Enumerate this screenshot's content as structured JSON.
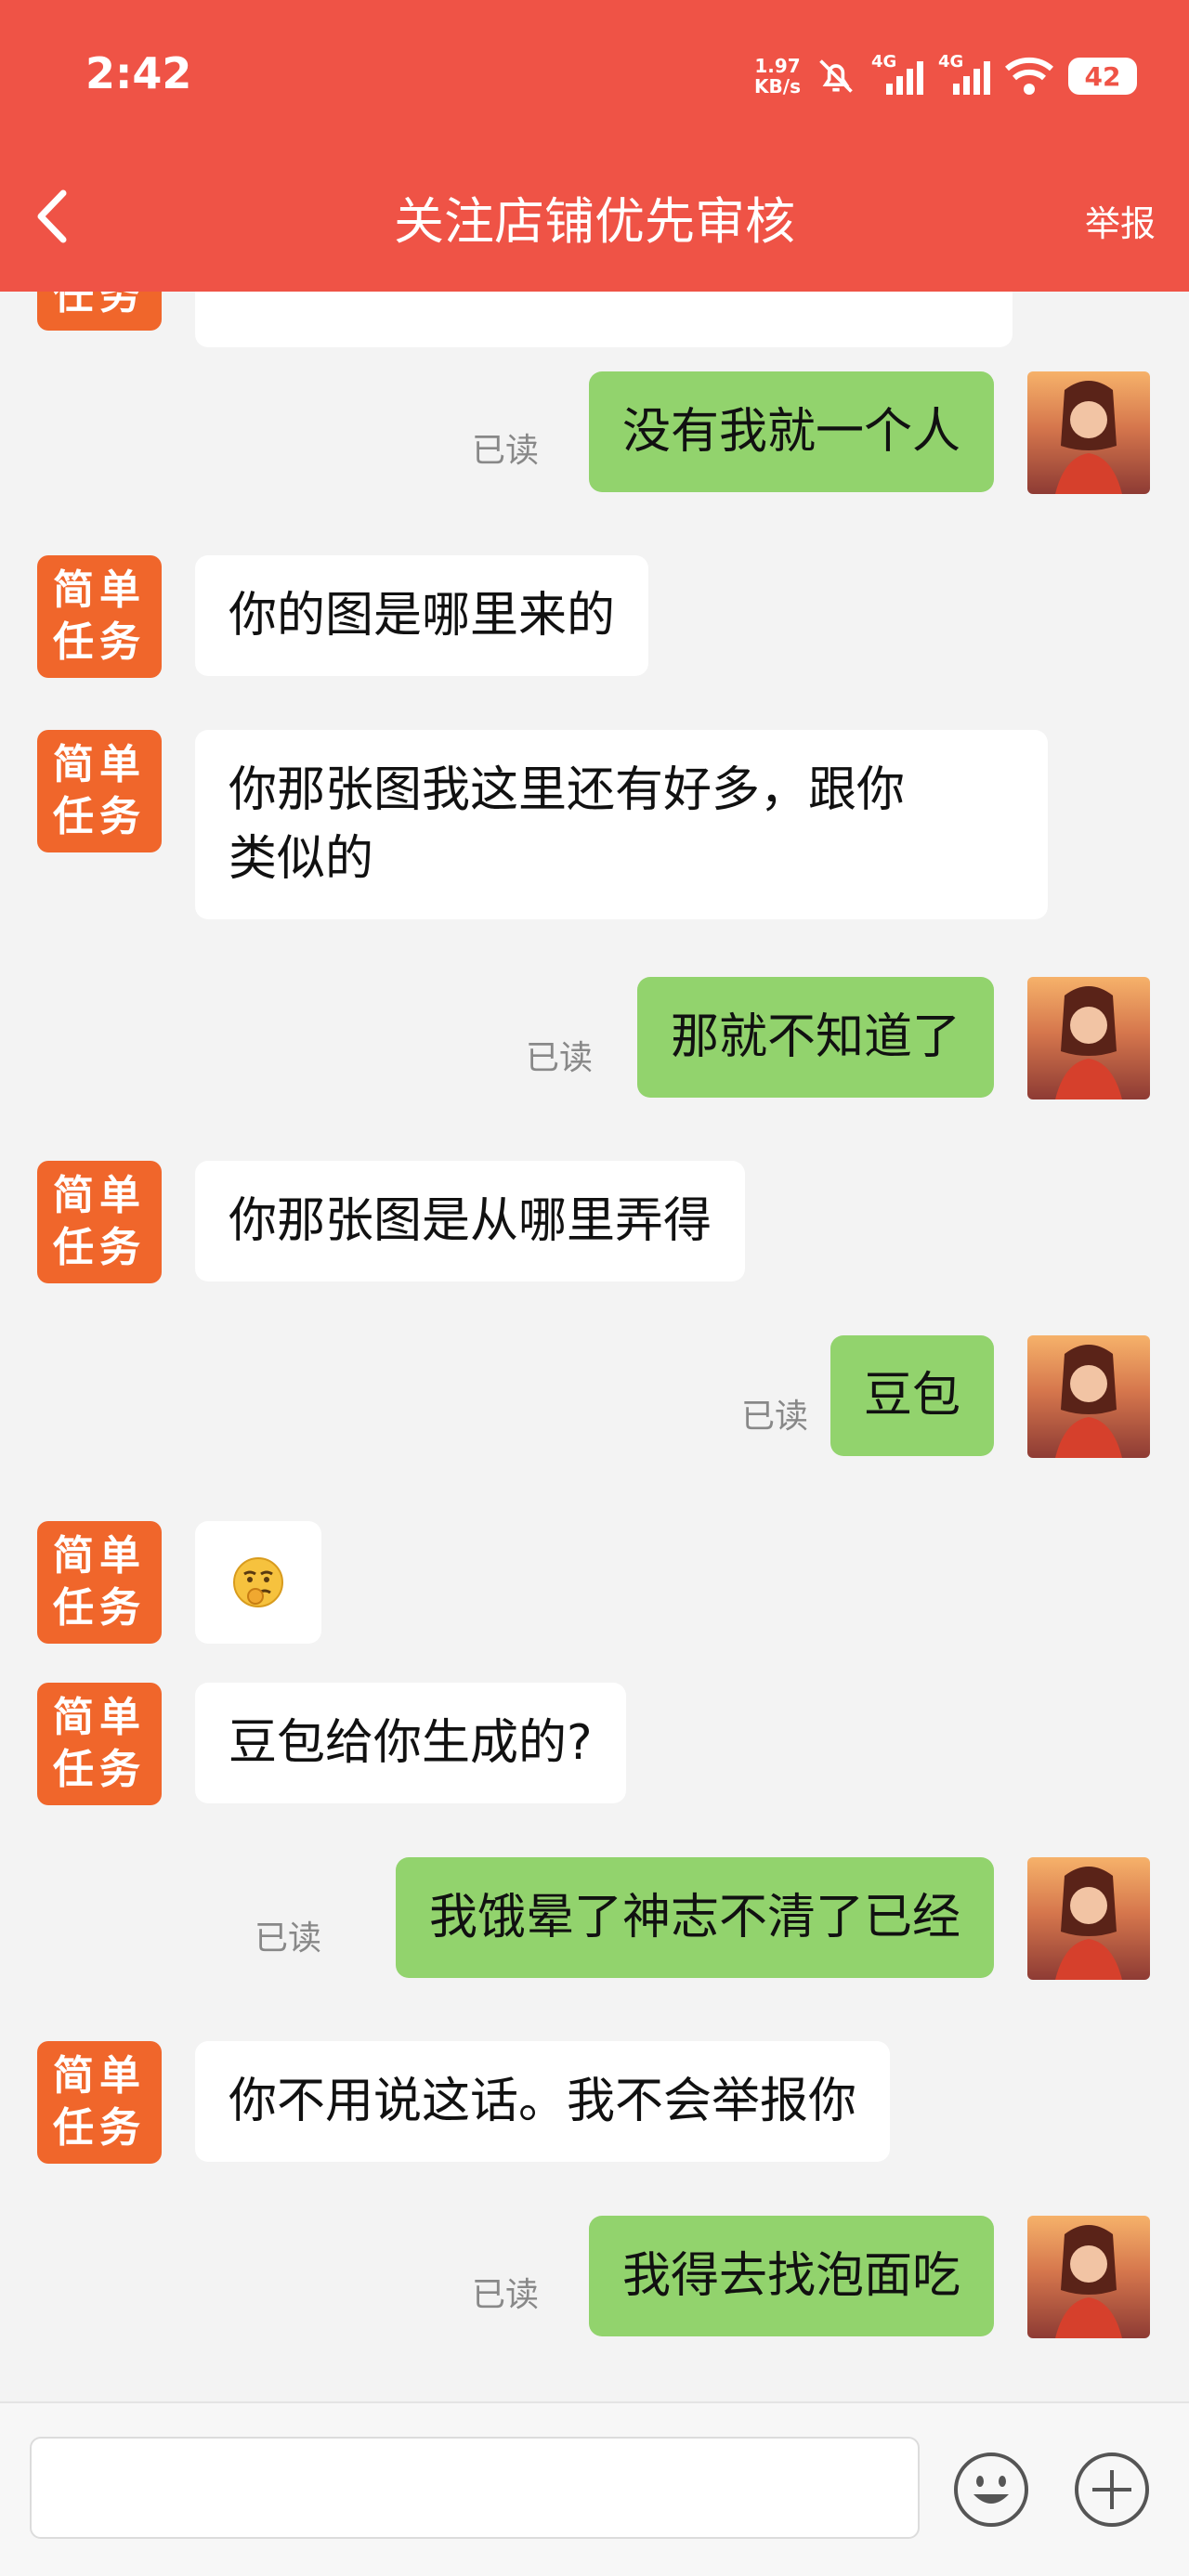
{
  "status_bar": {
    "time": "2:42",
    "net_speed": "1.97",
    "net_unit": "KB/s",
    "signal1": "4G",
    "signal2": "4G",
    "battery": "42"
  },
  "header": {
    "title": "关注店铺优先审核",
    "report": "举报"
  },
  "avatar_text": {
    "line1": "简单",
    "line2": "任务"
  },
  "read_label": "已读",
  "messages": [
    {
      "text": "没有我就一个人"
    },
    {
      "text": "你的图是哪里来的"
    },
    {
      "text": "你那张图我这里还有好多，跟你类似的",
      "line1": "你那张图我这里还有好多，跟你",
      "line2": "类似的"
    },
    {
      "text": "那就不知道了"
    },
    {
      "text": "你那张图是从哪里弄得"
    },
    {
      "text": "豆包"
    },
    {
      "text": "[emoji]",
      "icon": "thinking-emoji-icon"
    },
    {
      "text": "豆包给你生成的?"
    },
    {
      "text": "我饿晕了神志不清了已经"
    },
    {
      "text": "你不用说这话。我不会举报你"
    },
    {
      "text": "我得去找泡面吃"
    }
  ],
  "colors": {
    "accent": "#ef5346",
    "task_avatar": "#f0662b",
    "outgoing": "#92d36d"
  }
}
